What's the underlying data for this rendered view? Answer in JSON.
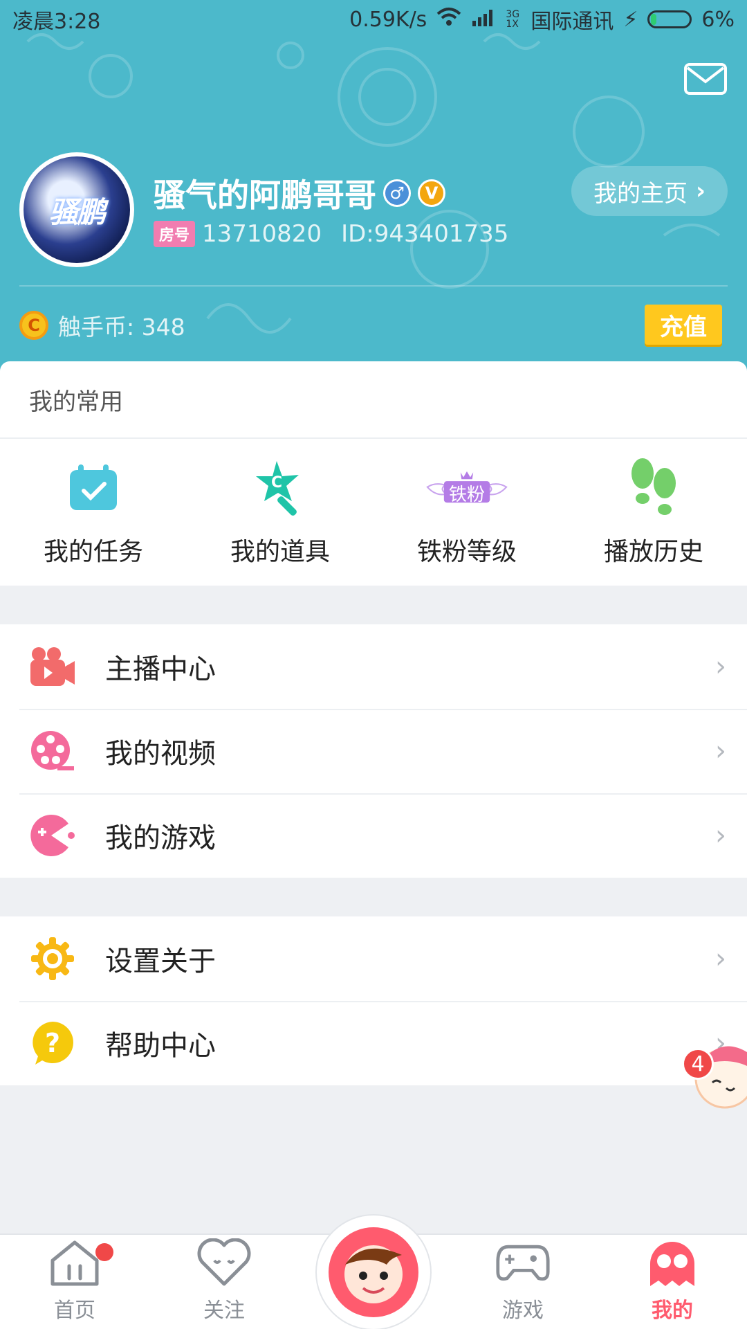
{
  "status_bar": {
    "time": "凌晨3:28",
    "net_speed": "0.59K/s",
    "network_type": "3G 1X",
    "carrier": "国际通讯",
    "battery": "6%"
  },
  "header": {
    "username": "骚气的阿鹏哥哥",
    "avatar_text": "骚鹏",
    "room_tag": "房号",
    "room_number": "13710820",
    "user_id": "ID:943401735",
    "home_button": "我的主页",
    "coin_label": "触手币: 348",
    "recharge_button": "充值",
    "colors": {
      "header_bg": "#4cb9cb",
      "recharge": "#ffc81e"
    }
  },
  "common": {
    "title": "我的常用",
    "items": [
      {
        "label": "我的任务",
        "icon": "calendar-check-icon"
      },
      {
        "label": "我的道具",
        "icon": "magic-wand-icon"
      },
      {
        "label": "铁粉等级",
        "icon": "fan-level-badge-icon",
        "badge_text": "铁粉"
      },
      {
        "label": "播放历史",
        "icon": "footprints-icon"
      }
    ]
  },
  "menu_group_1": [
    {
      "label": "主播中心",
      "icon": "video-camera-icon"
    },
    {
      "label": "我的视频",
      "icon": "film-reel-icon"
    },
    {
      "label": "我的游戏",
      "icon": "pacman-icon"
    }
  ],
  "menu_group_2": [
    {
      "label": "设置关于",
      "icon": "gear-icon"
    },
    {
      "label": "帮助中心",
      "icon": "help-bubble-icon"
    }
  ],
  "floating": {
    "badge_count": "4"
  },
  "bottom_nav": [
    {
      "label": "首页",
      "icon": "home-icon"
    },
    {
      "label": "关注",
      "icon": "heart-face-icon"
    },
    {
      "label": "游戏",
      "icon": "gamepad-icon"
    },
    {
      "label": "我的",
      "icon": "ghost-glasses-icon",
      "active": true
    }
  ]
}
